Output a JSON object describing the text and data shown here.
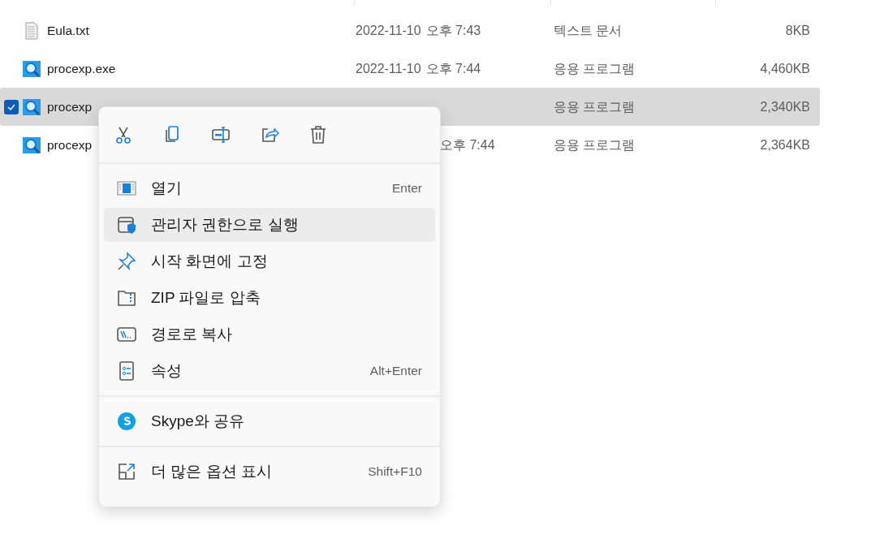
{
  "files": [
    {
      "name": "Eula.txt",
      "date": "2022-11-10",
      "time": "오후 7:43",
      "type": "텍스트 문서",
      "size": "8KB",
      "kind": "text",
      "selected": false
    },
    {
      "name": "procexp.exe",
      "date": "2022-11-10",
      "time": "오후 7:44",
      "type": "응용 프로그램",
      "size": "4,460KB",
      "kind": "app",
      "selected": false
    },
    {
      "name": "procexp",
      "type": "응용 프로그램",
      "size": "2,340KB",
      "kind": "app",
      "selected": true
    },
    {
      "name": "procexp",
      "time": "오후 7:44",
      "type": "응용 프로그램",
      "size": "2,364KB",
      "kind": "app",
      "selected": false
    }
  ],
  "context_menu": {
    "sections": [
      [
        {
          "label": "열기",
          "shortcut": "Enter",
          "highlighted": false
        },
        {
          "label": "관리자 권한으로 실행",
          "highlighted": true
        },
        {
          "label": "시작 화면에 고정",
          "highlighted": false
        },
        {
          "label": "ZIP 파일로 압축",
          "highlighted": false
        },
        {
          "label": "경로로 복사",
          "highlighted": false
        },
        {
          "label": "속성",
          "shortcut": "Alt+Enter",
          "highlighted": false
        }
      ],
      [
        {
          "label": "Skype와 공유",
          "highlighted": false
        }
      ],
      [
        {
          "label": "더 많은 옵션 표시",
          "shortcut": "Shift+F10",
          "highlighted": false
        }
      ]
    ]
  }
}
